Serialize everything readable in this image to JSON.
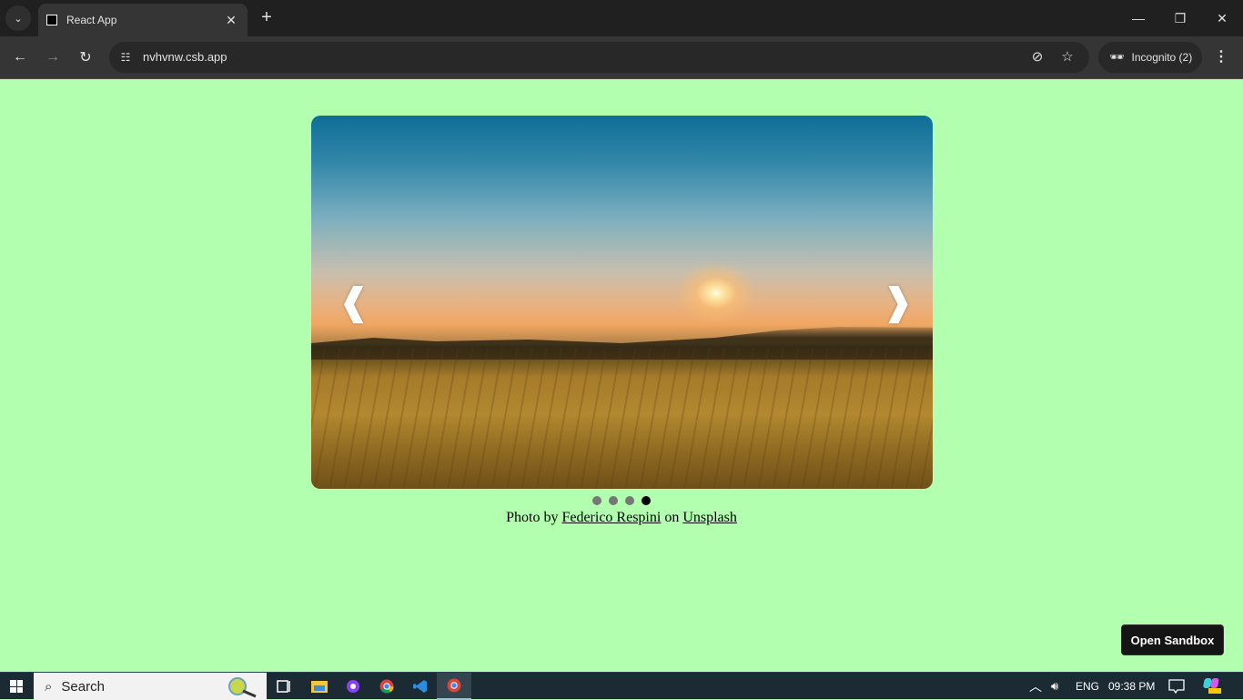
{
  "browser": {
    "tab": {
      "title": "React App",
      "favicon": "square-icon",
      "close_icon": "close-icon"
    },
    "tab_search_icon": "chevron-down-icon",
    "new_tab_icon": "plus-icon",
    "window_controls": {
      "minimize": "minimize-icon",
      "restore": "restore-icon",
      "close": "close-icon"
    },
    "toolbar": {
      "back_icon": "arrow-left-icon",
      "forward_icon": "arrow-right-icon",
      "reload_icon": "reload-icon",
      "site_info_icon": "tune-icon",
      "url": "nvhvnw.csb.app",
      "eye_off_icon": "eye-off-icon",
      "bookmark_icon": "star-icon",
      "incognito_label": "Incognito (2)",
      "menu_icon": "kebab-icon"
    }
  },
  "page": {
    "background": "#b3ffb0",
    "carousel": {
      "image_alt": "Golden wheat field at sunset",
      "prev_glyph": "❰",
      "next_glyph": "❱",
      "slides_total": 4,
      "active_index": 3
    },
    "credit": {
      "prefix": "Photo by ",
      "author": "Federico Respini",
      "middle": " on ",
      "source": "Unsplash"
    },
    "open_sandbox_label": "Open Sandbox"
  },
  "taskbar": {
    "search_placeholder": "Search",
    "apps": [
      "task-view-icon",
      "file-explorer-icon",
      "github-desktop-icon",
      "chrome-icon",
      "vscode-icon",
      "chrome-incognito-icon"
    ],
    "tray": {
      "chevron": "^",
      "language": "ENG",
      "time": "09:38 PM"
    }
  }
}
